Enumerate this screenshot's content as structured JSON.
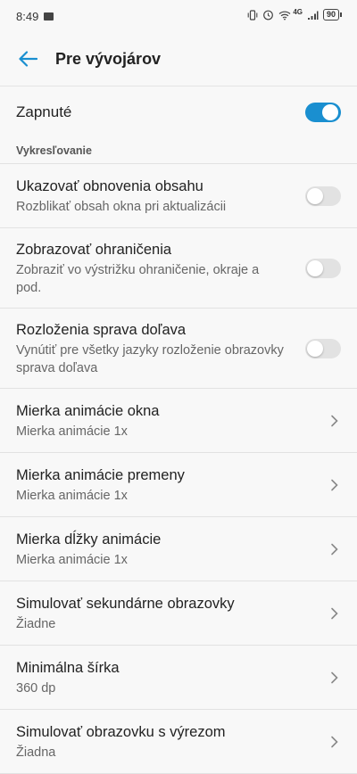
{
  "status_bar": {
    "time": "8:49",
    "network": "4G",
    "battery": "90"
  },
  "app_bar": {
    "title": "Pre vývojárov"
  },
  "main_toggle": {
    "label": "Zapnuté",
    "state": "on"
  },
  "section": {
    "header": "Vykresľovanie"
  },
  "items": [
    {
      "title": "Ukazovať obnovenia obsahu",
      "subtitle": "Rozblikať obsah okna pri aktualizácii",
      "control": "toggle",
      "state": "off"
    },
    {
      "title": "Zobrazovať ohraničenia",
      "subtitle": "Zobraziť vo výstrižku ohraničenie, okraje a pod.",
      "control": "toggle",
      "state": "off"
    },
    {
      "title": "Rozloženia sprava doľava",
      "subtitle": "Vynútiť pre všetky jazyky rozloženie obrazovky sprava doľava",
      "control": "toggle",
      "state": "off"
    },
    {
      "title": "Mierka animácie okna",
      "subtitle": "Mierka animácie 1x",
      "control": "chevron"
    },
    {
      "title": "Mierka animácie premeny",
      "subtitle": "Mierka animácie 1x",
      "control": "chevron"
    },
    {
      "title": "Mierka dĺžky animácie",
      "subtitle": "Mierka animácie 1x",
      "control": "chevron"
    },
    {
      "title": "Simulovať sekundárne obrazovky",
      "subtitle": "Žiadne",
      "control": "chevron"
    },
    {
      "title": "Minimálna šírka",
      "subtitle": "360 dp",
      "control": "chevron"
    },
    {
      "title": "Simulovať obrazovku s výrezom",
      "subtitle": "Žiadna",
      "control": "chevron"
    }
  ],
  "colors": {
    "accent": "#1a8fd0",
    "background": "#f8f8f8"
  }
}
